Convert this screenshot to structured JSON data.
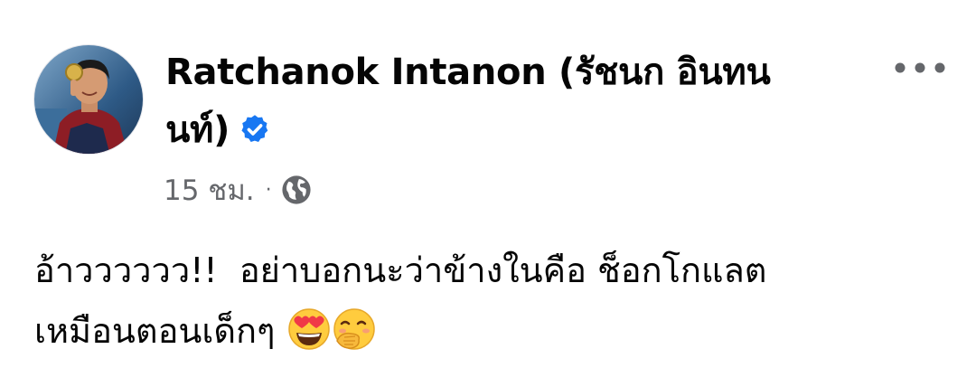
{
  "post": {
    "author": "Ratchanok Intanon (รัชนก อินทนนท์)",
    "verified": true,
    "time": "15 ชม.",
    "separator": "·",
    "audience_icon": "globe-icon",
    "text_line1": "อ้าวววววว!!  อย่าบอกนะว่าข้างในคือ ช็อกโกแลต",
    "text_line2": "เหมือนตอนเด็กๆ",
    "emojis": [
      "heart-eyes-emoji",
      "hand-over-mouth-emoji"
    ]
  },
  "colors": {
    "text": "#050505",
    "secondary_text": "#65676b",
    "verified_blue": "#1877f2",
    "background": "#ffffff"
  }
}
